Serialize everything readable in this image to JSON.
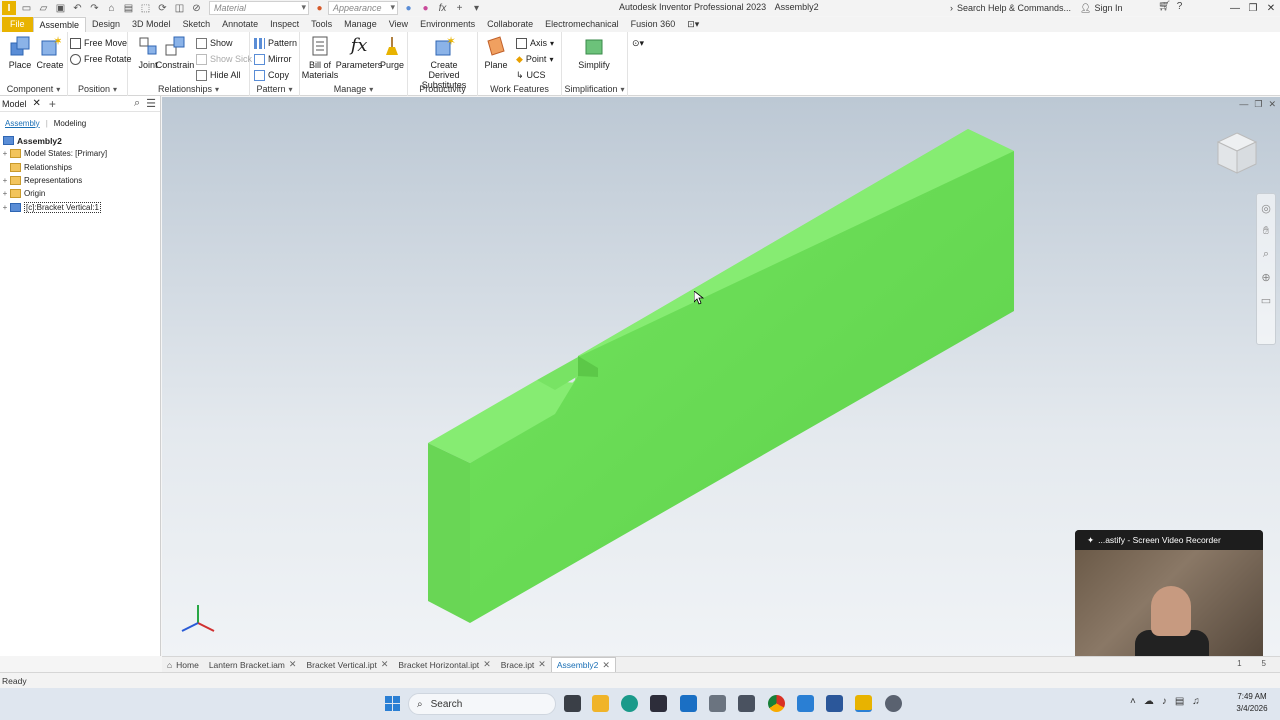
{
  "titlebar": {
    "material_dropdown": "Material",
    "appearance_dropdown": "Appearance",
    "title": "Autodesk Inventor Professional 2023",
    "document": "Assembly2",
    "search_help": "Search Help & Commands...",
    "sign_in": "Sign In"
  },
  "tabs": [
    "File",
    "Assemble",
    "Design",
    "3D Model",
    "Sketch",
    "Annotate",
    "Inspect",
    "Tools",
    "Manage",
    "View",
    "Environments",
    "Collaborate",
    "Electromechanical",
    "Fusion 360"
  ],
  "ribbon": {
    "component": {
      "label": "Component",
      "place": "Place",
      "create": "Create"
    },
    "position": {
      "label": "Position",
      "free_move": "Free Move",
      "free_rotate": "Free Rotate"
    },
    "relationships": {
      "label": "Relationships",
      "joint": "Joint",
      "constrain": "Constrain",
      "show": "Show",
      "show_sick": "Show Sick",
      "hide_all": "Hide All"
    },
    "pattern": {
      "label": "Pattern",
      "pattern": "Pattern",
      "mirror": "Mirror",
      "copy": "Copy"
    },
    "manage": {
      "label": "Manage",
      "bom_line1": "Bill of",
      "bom_line2": "Materials",
      "parameters": "Parameters",
      "purge": "Purge"
    },
    "productivity": {
      "label": "Productivity",
      "cds_line1": "Create Derived",
      "cds_line2": "Substitutes"
    },
    "work_features": {
      "label": "Work Features",
      "plane": "Plane",
      "axis": "Axis",
      "point": "Point",
      "ucs": "UCS"
    },
    "simplification": {
      "label": "Simplification",
      "simplify": "Simplify"
    }
  },
  "browser": {
    "title": "Model",
    "tab_assembly": "Assembly",
    "tab_modeling": "Modeling",
    "root": "Assembly2",
    "items": [
      {
        "label": "Model States: [Primary]"
      },
      {
        "label": "Relationships"
      },
      {
        "label": "Representations"
      },
      {
        "label": "Origin"
      },
      {
        "label": "[c]:Bracket Vertical:1"
      }
    ]
  },
  "recorder": {
    "title": "...astify - Screen Video Recorder"
  },
  "doc_tabs": [
    {
      "label": "Home"
    },
    {
      "label": "Lantern Bracket.iam"
    },
    {
      "label": "Bracket Vertical.ipt"
    },
    {
      "label": "Bracket Horizontal.ipt"
    },
    {
      "label": "Brace.ipt"
    },
    {
      "label": "Assembly2"
    }
  ],
  "page_nums": [
    "1",
    "5"
  ],
  "status": "Ready",
  "taskbar": {
    "search": "Search",
    "time": "7:49 AM",
    "date": "3/4/2026"
  },
  "colors": {
    "part_green": "#6fe05a",
    "accent": "#e8b300",
    "link_blue": "#1a6fb5"
  }
}
